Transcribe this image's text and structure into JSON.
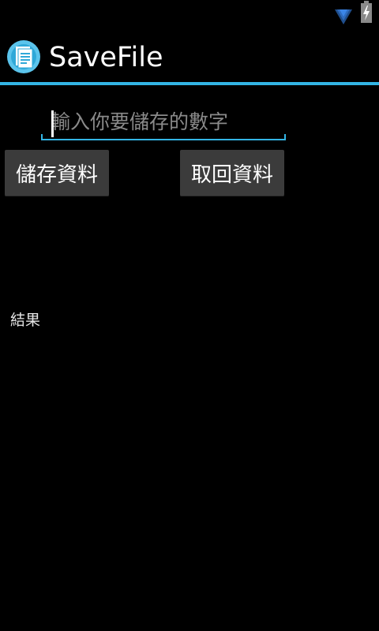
{
  "status_bar": {
    "wifi_icon": "wifi-icon",
    "battery_icon": "battery-charging-icon"
  },
  "action_bar": {
    "app_icon": "document-icon",
    "title": "SaveFile",
    "accent_color": "#33b5e5"
  },
  "form": {
    "input_value": "",
    "input_placeholder": "輸入你要儲存的數字",
    "save_button_label": "儲存資料",
    "load_button_label": "取回資料"
  },
  "result": {
    "label": "結果"
  }
}
